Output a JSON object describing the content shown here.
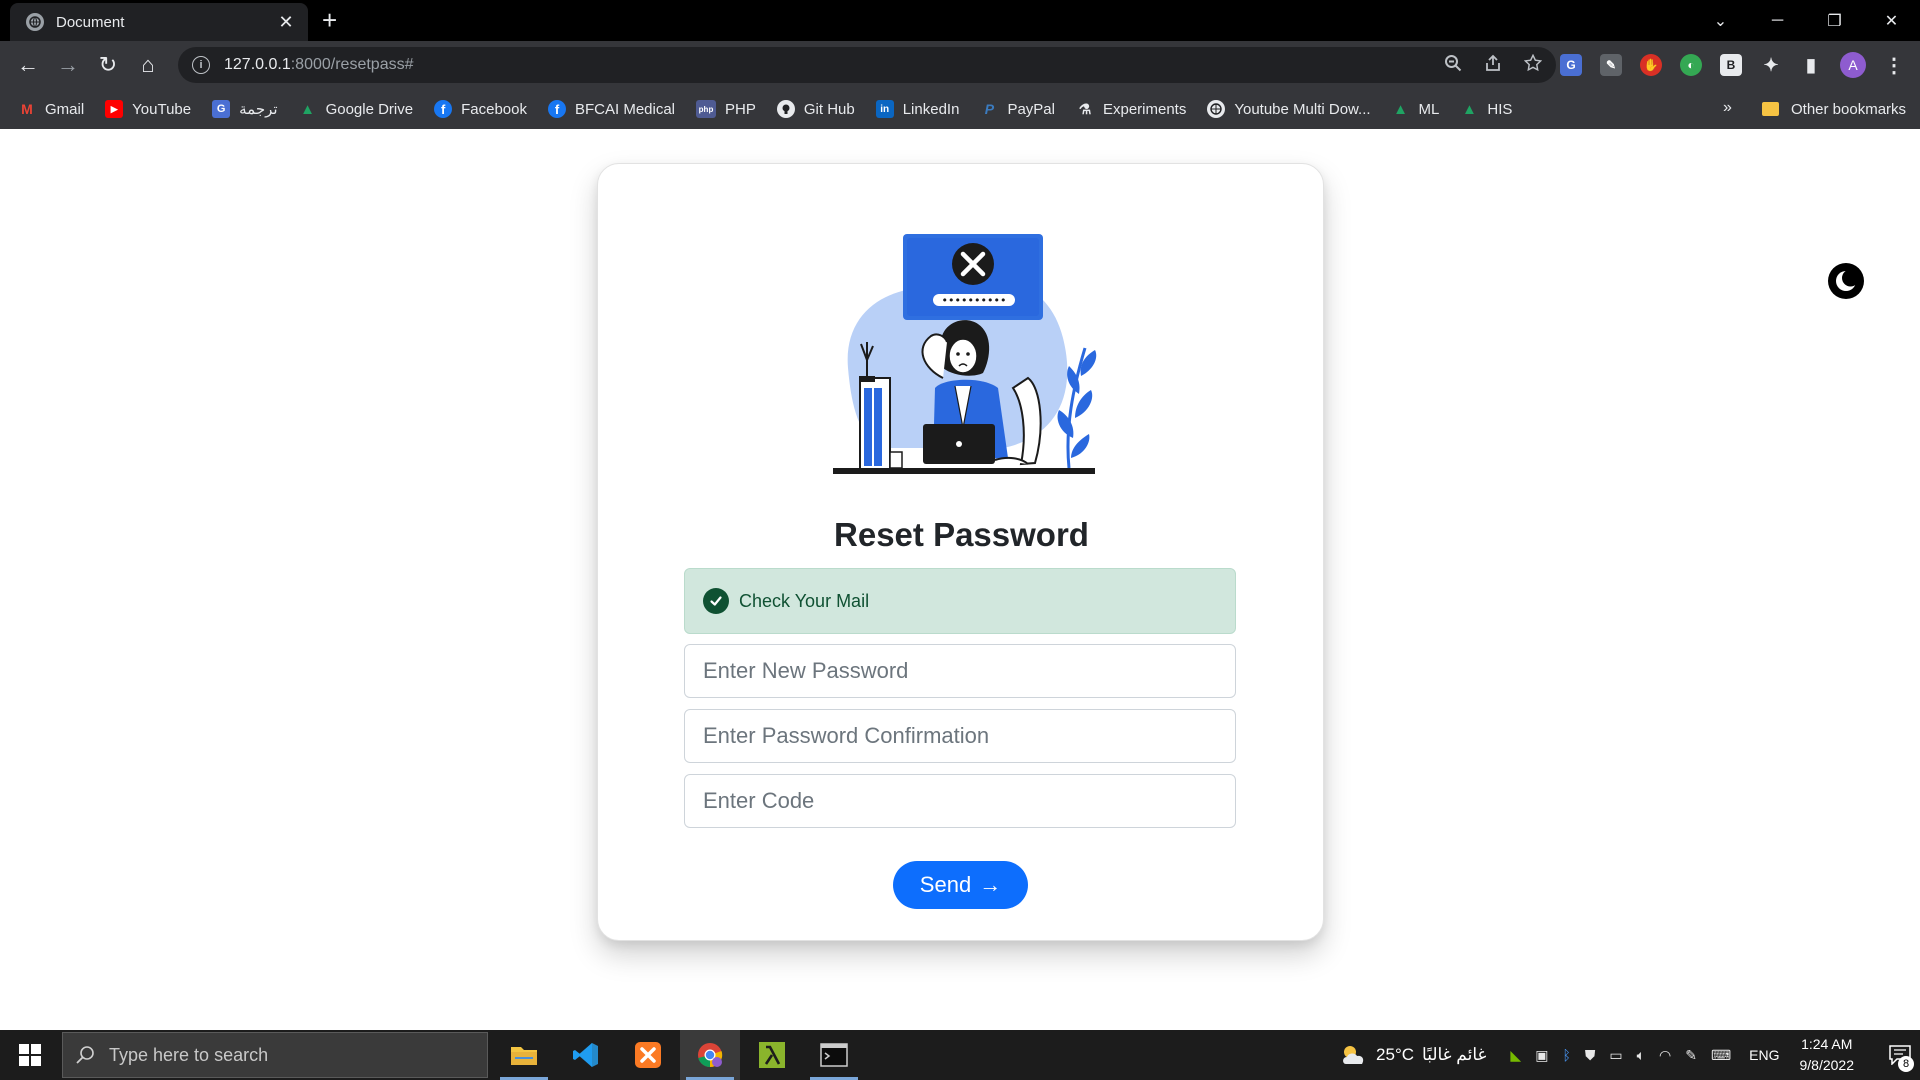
{
  "browser": {
    "tab": {
      "title": "Document",
      "close": "✕"
    },
    "new_tab": "+",
    "window_controls": {
      "tab_search": "⌄",
      "minimize": "─",
      "restore": "❐",
      "close": "✕"
    },
    "nav": {
      "back": "←",
      "forward": "→",
      "reload": "↻",
      "home": "⌂"
    },
    "url": {
      "host": "127.0.0.1",
      "rest": ":8000/resetpass#"
    },
    "omnibox_icons": [
      "zoom-icon",
      "share-icon",
      "bookmark-star-icon"
    ],
    "extensions": [
      {
        "name": "translate-extension-icon",
        "label": "G",
        "color": "#4a6fd3"
      },
      {
        "name": "pen-extension-icon",
        "label": "✎",
        "color": "#5f6368"
      },
      {
        "name": "adblock-extension-icon",
        "label": "✋",
        "color": "#d93025"
      },
      {
        "name": "colorful-extension-icon",
        "label": "◐",
        "color": "#34a853"
      },
      {
        "name": "b-extension-icon",
        "label": "B",
        "color": "#e8eaed"
      },
      {
        "name": "puzzle-extensions-icon",
        "label": "✦",
        "color": "#35363a"
      },
      {
        "name": "sidepanel-icon",
        "label": "▮",
        "color": "#35363a"
      }
    ],
    "profile_initial": "A",
    "menu": "⋮",
    "bookmarks": [
      {
        "label": "Gmail",
        "icon": "gmail-icon",
        "color": "#ea4335",
        "glyph": "M"
      },
      {
        "label": "YouTube",
        "icon": "youtube-icon",
        "color": "#ff0000",
        "glyph": "▶"
      },
      {
        "label": "ترجمة",
        "icon": "translate-icon",
        "color": "#4a6fd3",
        "glyph": "G"
      },
      {
        "label": "Google Drive",
        "icon": "google-drive-icon",
        "color": "#1fa463",
        "glyph": "▲"
      },
      {
        "label": "Facebook",
        "icon": "facebook-icon",
        "color": "#1877f2",
        "glyph": "f"
      },
      {
        "label": "BFCAI Medical",
        "icon": "facebook-icon",
        "color": "#1877f2",
        "glyph": "f"
      },
      {
        "label": "PHP",
        "icon": "php-icon",
        "color": "#4f5b93",
        "glyph": "php"
      },
      {
        "label": "Git Hub",
        "icon": "github-icon",
        "color": "#e8eaed",
        "glyph": "●"
      },
      {
        "label": "LinkedIn",
        "icon": "linkedin-icon",
        "color": "#0a66c2",
        "glyph": "in"
      },
      {
        "label": "PayPal",
        "icon": "paypal-icon",
        "color": "#003087",
        "glyph": "P"
      },
      {
        "label": "Experiments",
        "icon": "flask-icon",
        "color": "#35363a",
        "glyph": "⚗"
      },
      {
        "label": "Youtube Multi Dow...",
        "icon": "globe-icon",
        "color": "#35363a",
        "glyph": "◍"
      },
      {
        "label": "ML",
        "icon": "google-drive-icon",
        "color": "#1fa463",
        "glyph": "▲"
      },
      {
        "label": "HIS",
        "icon": "google-drive-icon",
        "color": "#1fa463",
        "glyph": "▲"
      }
    ],
    "bookmarks_more": "»",
    "other_bookmarks": "Other bookmarks"
  },
  "page": {
    "title": "Reset Password",
    "alert": "Check Your Mail",
    "fields": {
      "new_password": "Enter New Password",
      "confirmation": "Enter Password Confirmation",
      "code": "Enter Code"
    },
    "send_label": "Send",
    "send_arrow": "→",
    "illustration_mask": "••••••••••"
  },
  "taskbar": {
    "search_placeholder": "Type here to search",
    "weather_temp": "25°C",
    "weather_text": "غائم غالبًا",
    "language": "ENG",
    "time": "1:24 AM",
    "date": "9/8/2022",
    "notifications": "8",
    "apps": [
      {
        "name": "file-explorer-icon",
        "active": false
      },
      {
        "name": "vscode-icon",
        "active": false
      },
      {
        "name": "xampp-icon",
        "active": false
      },
      {
        "name": "chrome-icon",
        "active": true
      },
      {
        "name": "lambda-app-icon",
        "active": false
      },
      {
        "name": "terminal-icon",
        "active": false
      }
    ]
  }
}
